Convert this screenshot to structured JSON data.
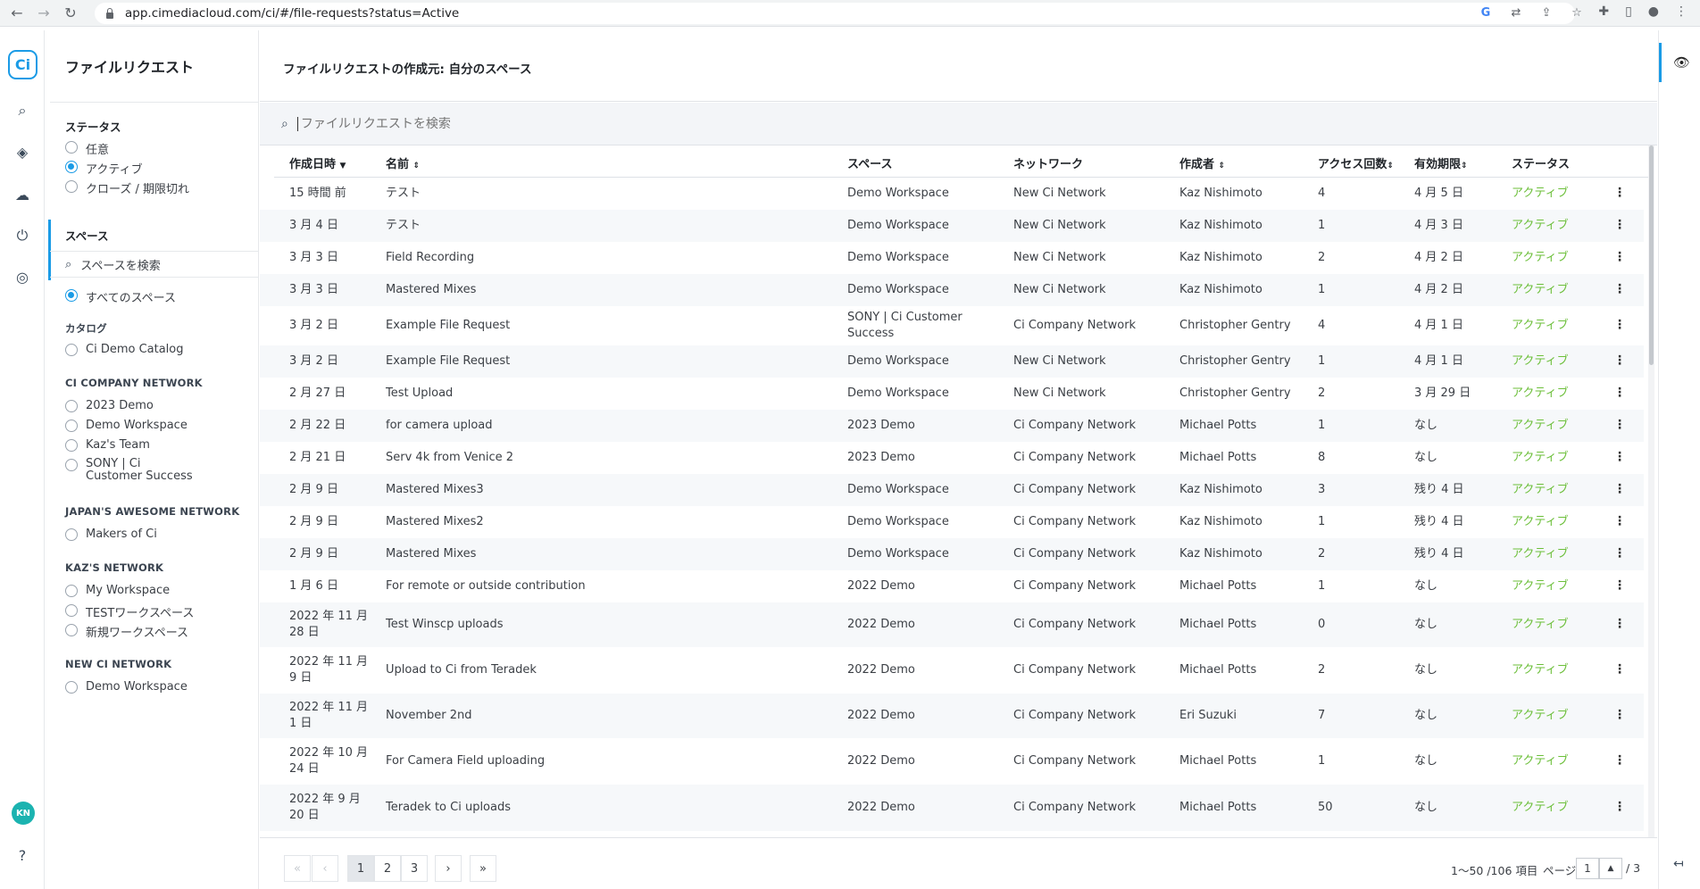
{
  "browser": {
    "url": "app.cimediacloud.com/ci/#/file-requests?status=Active"
  },
  "rail": {
    "logo": "Ci",
    "avatar": "KN"
  },
  "sidebar": {
    "title": "ファイルリクエスト",
    "status_heading": "ステータス",
    "status_options": [
      "任意",
      "アクティブ",
      "クローズ / 期限切れ"
    ],
    "status_selected": 1,
    "space_heading": "スペース",
    "space_search_placeholder": "スペースを検索",
    "all_spaces": "すべてのスペース",
    "groups": [
      {
        "name": "カタログ",
        "items": [
          "Ci Demo Catalog"
        ]
      },
      {
        "name": "CI COMPANY NETWORK",
        "items": [
          "2023 Demo",
          "Demo Workspace",
          "Kaz's Team",
          "SONY | Ci Customer Success"
        ]
      },
      {
        "name": "JAPAN'S AWESOME NETWORK",
        "items": [
          "Makers of Ci"
        ]
      },
      {
        "name": "KAZ'S NETWORK",
        "items": [
          "My Workspace",
          "TESTワークスペース",
          "新規ワークスペース"
        ]
      },
      {
        "name": "NEW CI NETWORK",
        "items": [
          "Demo Workspace"
        ]
      }
    ]
  },
  "main": {
    "title": "ファイルリクエストの作成元: 自分のスペース",
    "search_placeholder": "ファイルリクエストを検索"
  },
  "table": {
    "columns": [
      "作成日時",
      "名前",
      "スペース",
      "ネットワーク",
      "作成者",
      "アクセス回数",
      "有効期限",
      "ステータス"
    ],
    "rows": [
      {
        "date": "15 時間 前",
        "name": "テスト",
        "space": "Demo Workspace",
        "network": "New Ci Network",
        "creator": "Kaz Nishimoto",
        "access": "4",
        "expiry": "4 月 5 日",
        "status": "アクティブ"
      },
      {
        "date": "3 月 4 日",
        "name": "テスト",
        "space": "Demo Workspace",
        "network": "New Ci Network",
        "creator": "Kaz Nishimoto",
        "access": "1",
        "expiry": "4 月 3 日",
        "status": "アクティブ"
      },
      {
        "date": "3 月 3 日",
        "name": "Field Recording",
        "space": "Demo Workspace",
        "network": "New Ci Network",
        "creator": "Kaz Nishimoto",
        "access": "2",
        "expiry": "4 月 2 日",
        "status": "アクティブ"
      },
      {
        "date": "3 月 3 日",
        "name": "Mastered Mixes",
        "space": "Demo Workspace",
        "network": "New Ci Network",
        "creator": "Kaz Nishimoto",
        "access": "1",
        "expiry": "4 月 2 日",
        "status": "アクティブ"
      },
      {
        "date": "3 月 2 日",
        "name": "Example File Request",
        "space": "SONY | Ci Customer Success",
        "network": "Ci Company Network",
        "creator": "Christopher Gentry",
        "access": "4",
        "expiry": "4 月 1 日",
        "status": "アクティブ"
      },
      {
        "date": "3 月 2 日",
        "name": "Example File Request",
        "space": "Demo Workspace",
        "network": "New Ci Network",
        "creator": "Christopher Gentry",
        "access": "1",
        "expiry": "4 月 1 日",
        "status": "アクティブ"
      },
      {
        "date": "2 月 27 日",
        "name": "Test Upload",
        "space": "Demo Workspace",
        "network": "New Ci Network",
        "creator": "Christopher Gentry",
        "access": "2",
        "expiry": "3 月 29 日",
        "status": "アクティブ"
      },
      {
        "date": "2 月 22 日",
        "name": "for camera upload",
        "space": "2023 Demo",
        "network": "Ci Company Network",
        "creator": "Michael Potts",
        "access": "1",
        "expiry": "なし",
        "status": "アクティブ"
      },
      {
        "date": "2 月 21 日",
        "name": "Serv 4k from Venice 2",
        "space": "2023 Demo",
        "network": "Ci Company Network",
        "creator": "Michael Potts",
        "access": "8",
        "expiry": "なし",
        "status": "アクティブ"
      },
      {
        "date": "2 月 9 日",
        "name": "Mastered Mixes3",
        "space": "Demo Workspace",
        "network": "Ci Company Network",
        "creator": "Kaz Nishimoto",
        "access": "3",
        "expiry": "残り 4 日",
        "status": "アクティブ"
      },
      {
        "date": "2 月 9 日",
        "name": "Mastered Mixes2",
        "space": "Demo Workspace",
        "network": "Ci Company Network",
        "creator": "Kaz Nishimoto",
        "access": "1",
        "expiry": "残り 4 日",
        "status": "アクティブ"
      },
      {
        "date": "2 月 9 日",
        "name": "Mastered Mixes",
        "space": "Demo Workspace",
        "network": "Ci Company Network",
        "creator": "Kaz Nishimoto",
        "access": "2",
        "expiry": "残り 4 日",
        "status": "アクティブ"
      },
      {
        "date": "1 月 6 日",
        "name": "For remote or outside contribution",
        "space": "2022 Demo",
        "network": "Ci Company Network",
        "creator": "Michael Potts",
        "access": "1",
        "expiry": "なし",
        "status": "アクティブ"
      },
      {
        "date": "2022 年 11 月 28 日",
        "name": "Test Winscp uploads",
        "space": "2022 Demo",
        "network": "Ci Company Network",
        "creator": "Michael Potts",
        "access": "0",
        "expiry": "なし",
        "status": "アクティブ"
      },
      {
        "date": "2022 年 11 月 9 日",
        "name": "Upload to Ci from Teradek",
        "space": "2022 Demo",
        "network": "Ci Company Network",
        "creator": "Michael Potts",
        "access": "2",
        "expiry": "なし",
        "status": "アクティブ"
      },
      {
        "date": "2022 年 11 月 1 日",
        "name": "November 2nd",
        "space": "2022 Demo",
        "network": "Ci Company Network",
        "creator": "Eri Suzuki",
        "access": "7",
        "expiry": "なし",
        "status": "アクティブ"
      },
      {
        "date": "2022 年 10 月 24 日",
        "name": "For Camera Field uploading",
        "space": "2022 Demo",
        "network": "Ci Company Network",
        "creator": "Michael Potts",
        "access": "1",
        "expiry": "なし",
        "status": "アクティブ"
      },
      {
        "date": "2022 年 9 月 20 日",
        "name": "Teradek to Ci uploads",
        "space": "2022 Demo",
        "network": "Ci Company Network",
        "creator": "Michael Potts",
        "access": "50",
        "expiry": "なし",
        "status": "アクティブ"
      }
    ]
  },
  "pagination": {
    "pages": [
      "1",
      "2",
      "3"
    ],
    "current": "1",
    "summary": "1〜50 /106 項目",
    "page_label": "ページ",
    "page_total": "/ 3"
  }
}
